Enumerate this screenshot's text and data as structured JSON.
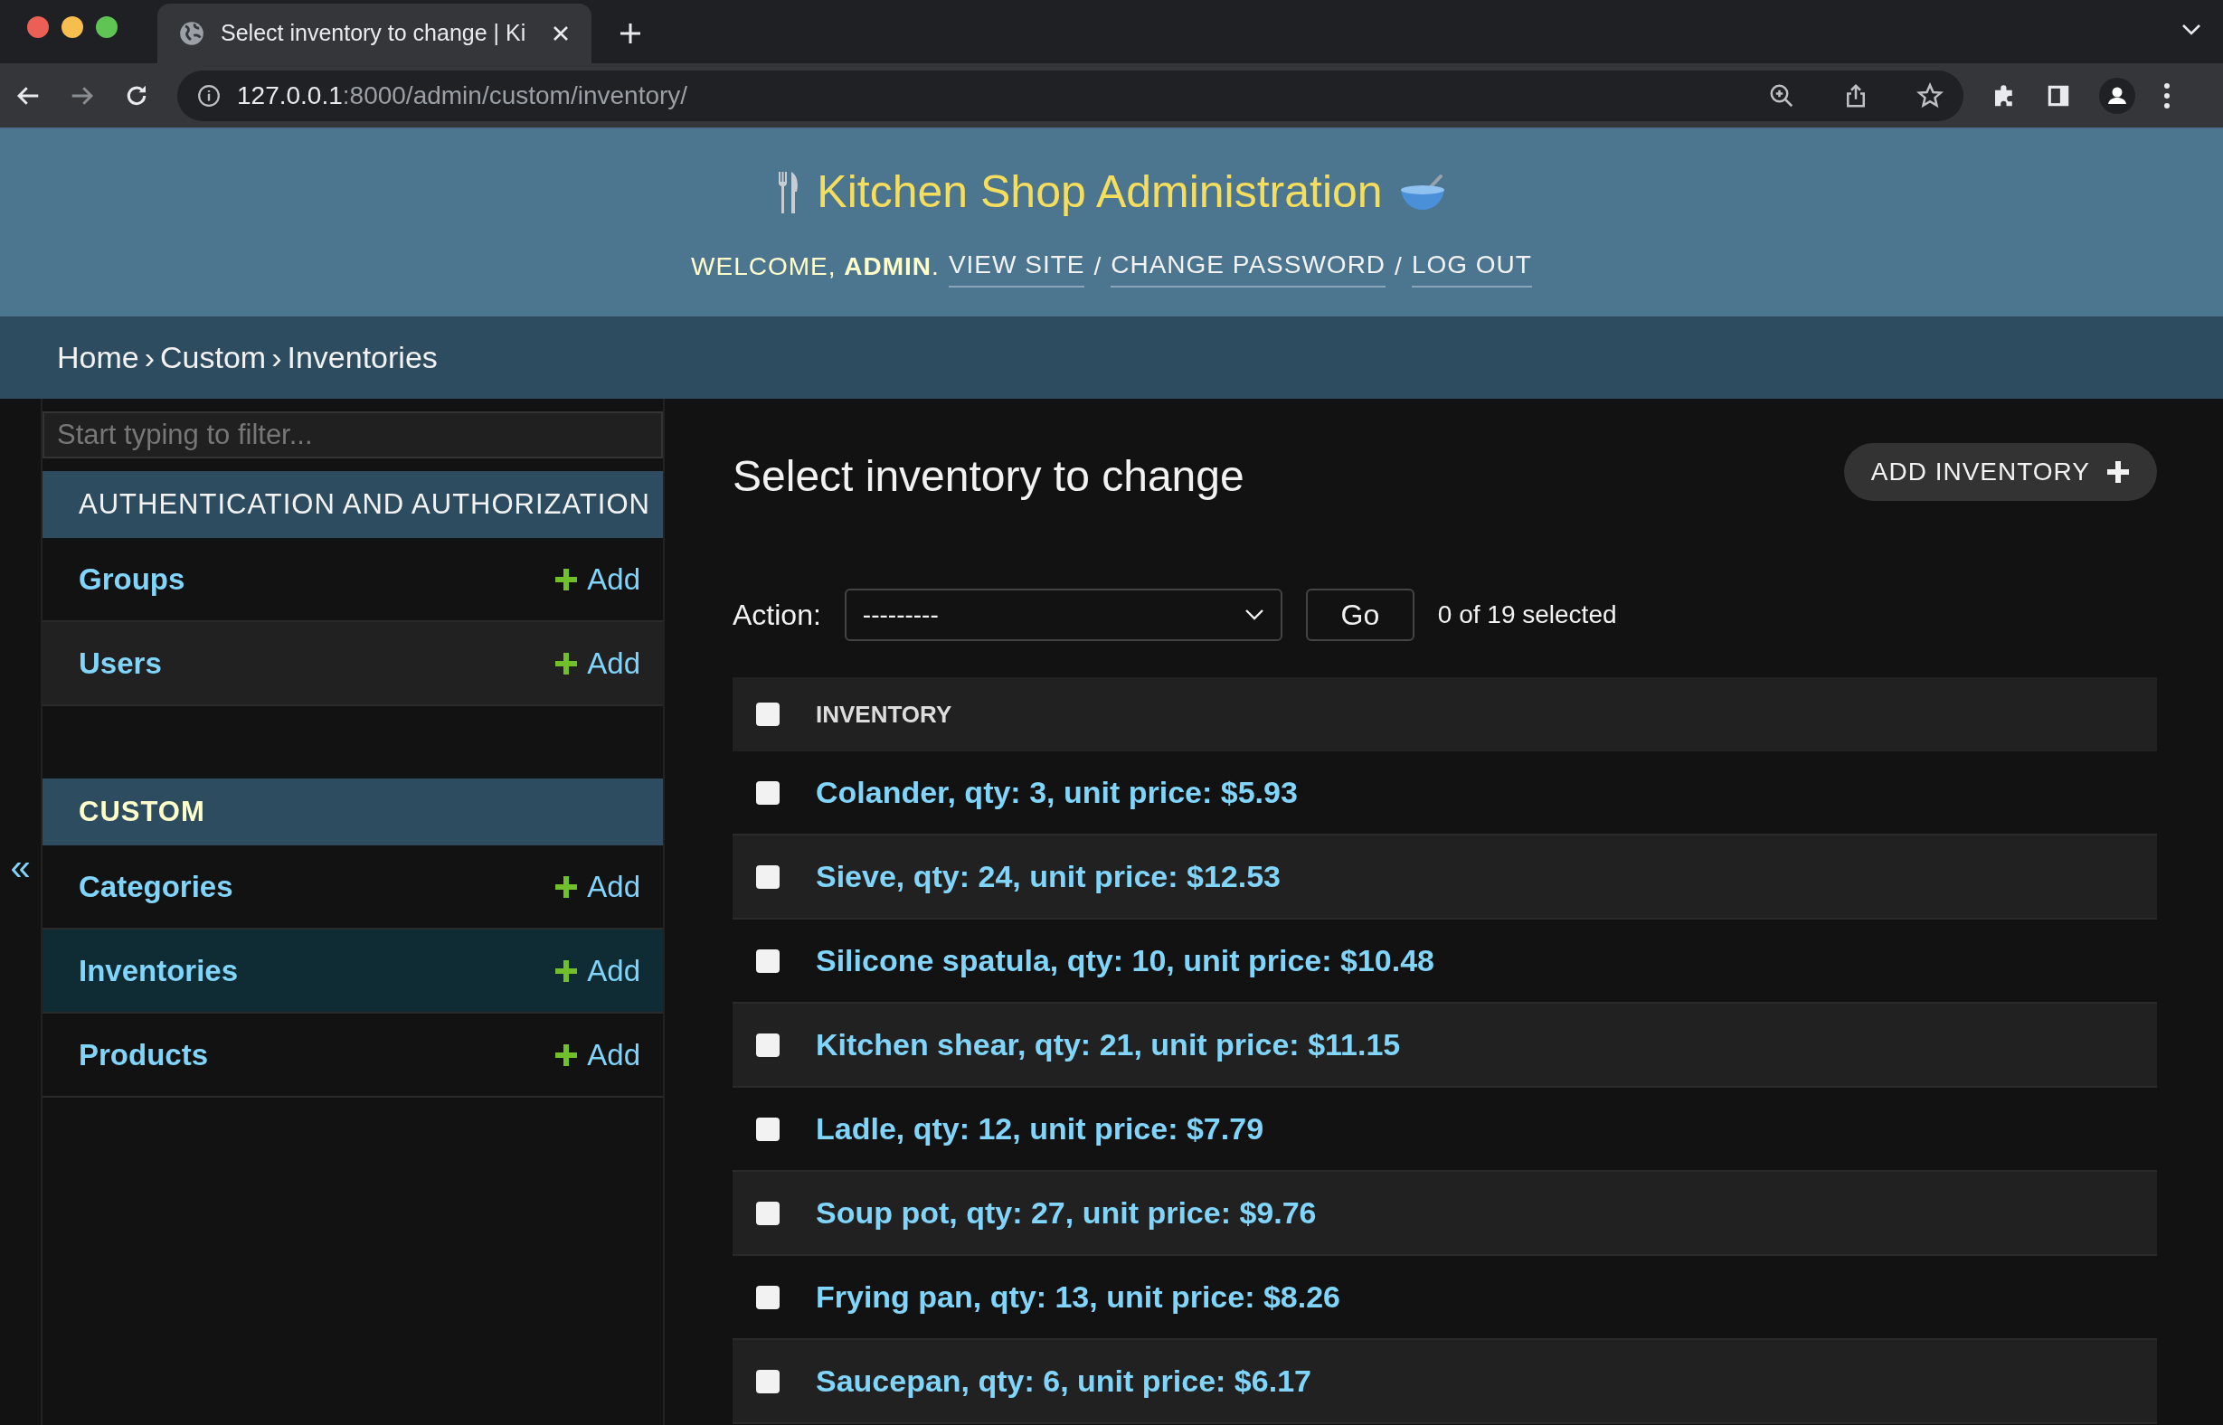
{
  "browser": {
    "tab_title": "Select inventory to change | Ki",
    "url_host": "127.0.0.1",
    "url_rest": ":8000/admin/custom/inventory/"
  },
  "header": {
    "title": "Kitchen Shop Administration",
    "welcome": "WELCOME, **ADMIN**.",
    "links": [
      "VIEW SITE",
      "CHANGE PASSWORD",
      "LOG OUT"
    ],
    "separator": "/"
  },
  "breadcrumbs": [
    "Home",
    "Custom",
    "Inventories"
  ],
  "breadcrumb_separator": "›",
  "sidebar": {
    "toggle": "«",
    "filter": {
      "placeholder": "Start typing to filter..."
    },
    "modules": [
      {
        "title": "AUTHENTICATION AND AUTHORIZATION",
        "items": [
          {
            "label": "Groups",
            "add": "Add",
            "selected": false
          },
          {
            "label": "Users",
            "add": "Add",
            "selected": false
          }
        ]
      },
      {
        "title": "CUSTOM",
        "items": [
          {
            "label": "Categories",
            "add": "Add",
            "selected": false
          },
          {
            "label": "Inventories",
            "add": "Add",
            "selected": true
          },
          {
            "label": "Products",
            "add": "Add",
            "selected": false
          }
        ]
      }
    ]
  },
  "main": {
    "title": "Select inventory to change",
    "add_button": "ADD INVENTORY",
    "action_label": "Action:",
    "action_value": "---------",
    "go": "Go",
    "selection_count": "0 of 19 selected",
    "table": {
      "column": "INVENTORY",
      "all_checked": false,
      "rows": [
        {
          "label": "Colander, qty: 3, unit price: $5.93",
          "checked": false
        },
        {
          "label": "Sieve, qty: 24, unit price: $12.53",
          "checked": false
        },
        {
          "label": "Silicone spatula, qty: 10, unit price: $10.48",
          "checked": false
        },
        {
          "label": "Kitchen shear, qty: 21, unit price: $11.15",
          "checked": false
        },
        {
          "label": "Ladle, qty: 12, unit price: $7.79",
          "checked": false
        },
        {
          "label": "Soup pot, qty: 27, unit price: $9.76",
          "checked": false
        },
        {
          "label": "Frying pan, qty: 13, unit price: $8.26",
          "checked": false
        },
        {
          "label": "Saucepan, qty: 6, unit price: $6.17",
          "checked": false
        }
      ]
    }
  }
}
